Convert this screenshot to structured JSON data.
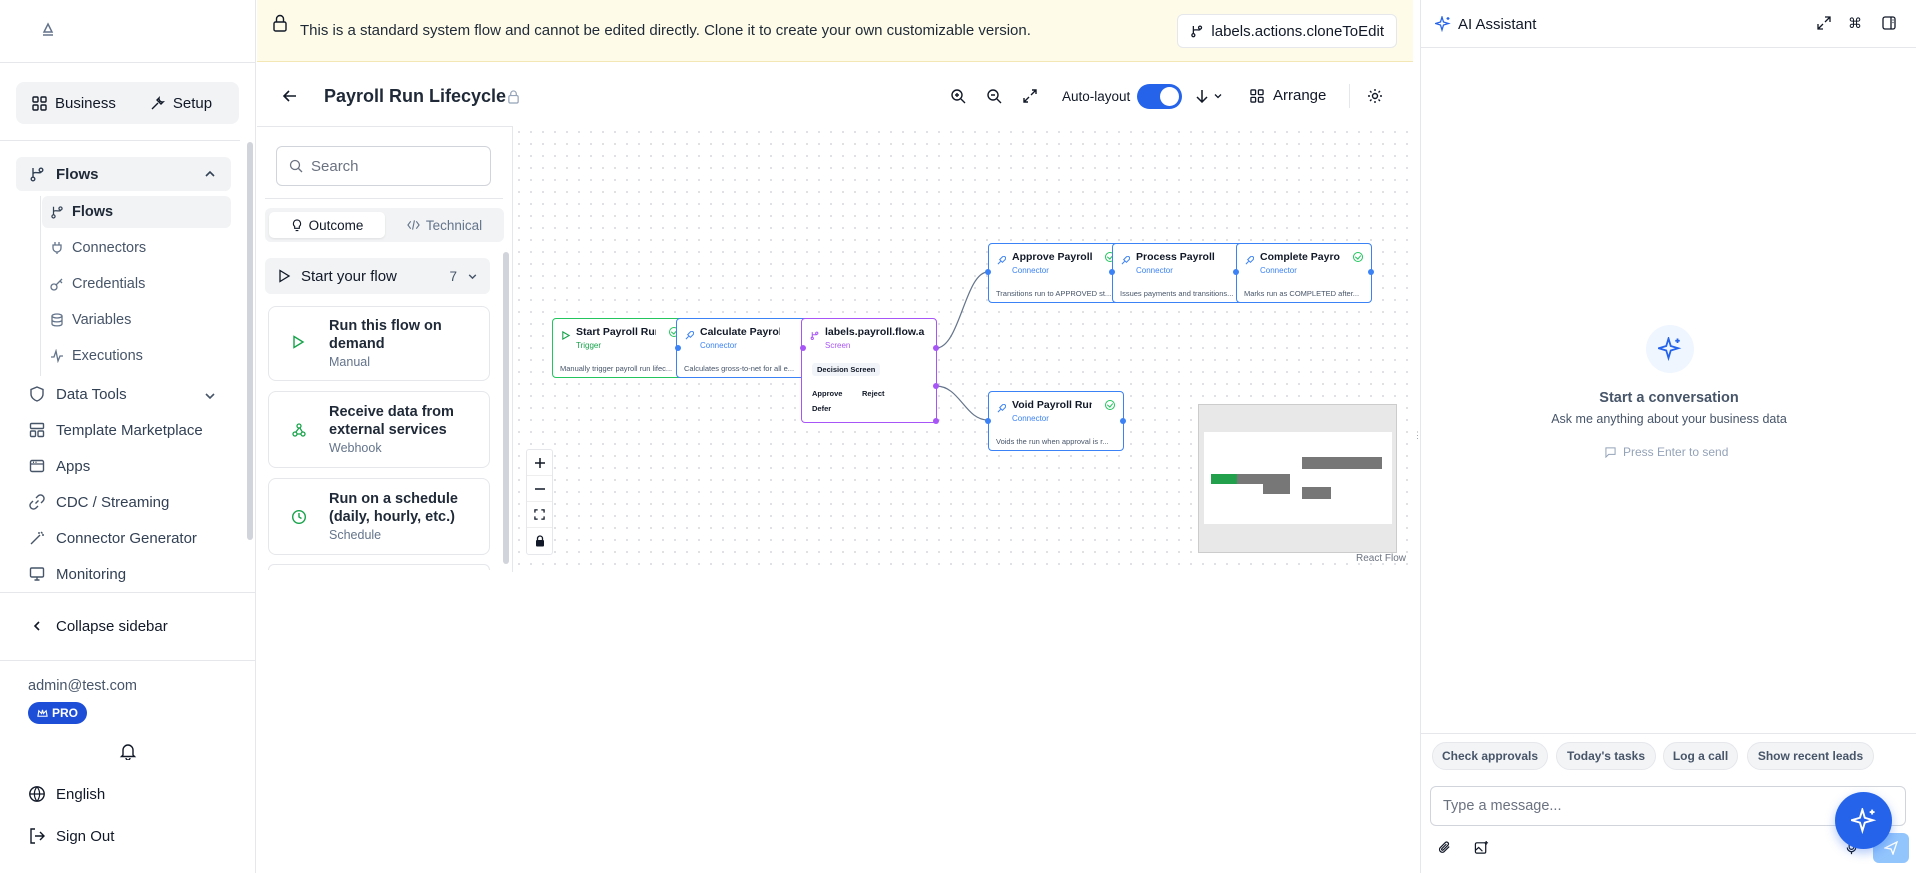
{
  "sidebar": {
    "mode_tabs": [
      {
        "label": "Business",
        "icon": "grid-icon"
      },
      {
        "label": "Setup",
        "icon": "wrench-icon"
      }
    ],
    "items": [
      {
        "label": "Flows",
        "icon": "branch-icon",
        "expanded": true
      },
      {
        "label": "Data Tools",
        "icon": "shield-icon"
      },
      {
        "label": "Template Marketplace",
        "icon": "layout-icon"
      },
      {
        "label": "Apps",
        "icon": "app-window-icon"
      },
      {
        "label": "CDC / Streaming",
        "icon": "link-icon"
      },
      {
        "label": "Connector Generator",
        "icon": "wand-icon"
      },
      {
        "label": "Monitoring",
        "icon": "monitor-icon"
      }
    ],
    "subitems": [
      {
        "label": "Flows",
        "icon": "branch-icon",
        "active": true
      },
      {
        "label": "Connectors",
        "icon": "plug-icon"
      },
      {
        "label": "Credentials",
        "icon": "key-icon"
      },
      {
        "label": "Variables",
        "icon": "database-icon"
      },
      {
        "label": "Executions",
        "icon": "activity-icon"
      }
    ],
    "collapse_label": "Collapse sidebar",
    "user_email": "admin@test.com",
    "plan_badge": "PRO",
    "language": "English",
    "sign_out": "Sign Out"
  },
  "banner": {
    "message": "This is a standard system flow and cannot be edited directly. Clone it to create your own customizable version.",
    "clone_label": "labels.actions.cloneToEdit"
  },
  "toolbar": {
    "title": "Payroll Run Lifecycle",
    "auto_layout_label": "Auto-layout",
    "auto_layout_on": true,
    "arrange_label": "Arrange"
  },
  "palette": {
    "search_placeholder": "Search",
    "tabs": [
      {
        "label": "Outcome",
        "active": true
      },
      {
        "label": "Technical",
        "active": false
      }
    ],
    "section_title": "Start your flow",
    "section_count": "7",
    "cards": [
      {
        "title": "Run this flow on demand",
        "subtitle": "Manual",
        "icon": "play-icon"
      },
      {
        "title": "Receive data from external services",
        "subtitle": "Webhook",
        "icon": "webhook-icon"
      },
      {
        "title": "Run on a schedule (daily, hourly, etc.)",
        "subtitle": "Schedule",
        "icon": "clock-icon"
      }
    ]
  },
  "flow": {
    "nodes": [
      {
        "title": "Start Payroll Run",
        "kind": "Trigger",
        "desc": "Manually trigger payroll run lifec..."
      },
      {
        "title": "Calculate Payroll ...",
        "kind": "Connector",
        "desc": "Calculates gross-to-net for all e..."
      },
      {
        "title": "labels.payroll.flow.a...",
        "kind": "Screen",
        "screen_label": "Decision Screen",
        "buttons": [
          "Approve",
          "Reject",
          "Defer"
        ]
      },
      {
        "title": "Approve Payroll R...",
        "kind": "Connector",
        "desc": "Transitions run to APPROVED st..."
      },
      {
        "title": "Process Payroll R...",
        "kind": "Connector",
        "desc": "Issues payments and transitions..."
      },
      {
        "title": "Complete Payroll ...",
        "kind": "Connector",
        "desc": "Marks run as COMPLETED after..."
      },
      {
        "title": "Void Payroll Run",
        "kind": "Connector",
        "desc": "Voids the run when approval is r..."
      }
    ],
    "attribution": "React Flow",
    "colors": {
      "trigger": "#22c55e",
      "connector": "#3b82f6",
      "screen": "#a855f7"
    }
  },
  "assistant": {
    "title": "AI Assistant",
    "empty_title": "Start a conversation",
    "empty_subtitle": "Ask me anything about your business data",
    "hint": "Press Enter to send",
    "chips": [
      "Check approvals",
      "Today's tasks",
      "Log a call",
      "Show recent leads"
    ],
    "input_placeholder": "Type a message..."
  }
}
